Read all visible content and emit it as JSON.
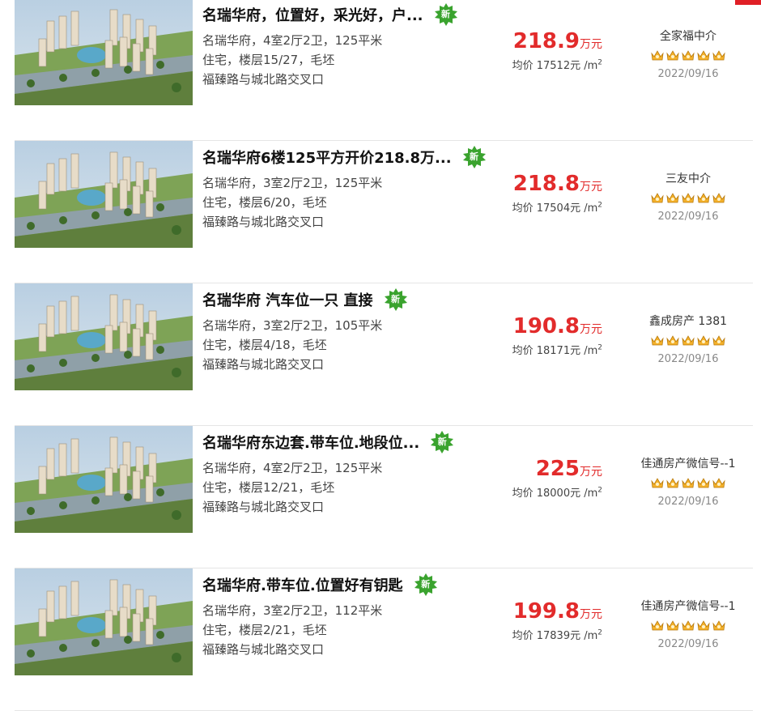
{
  "accent_color": "#e22b2b",
  "new_badge_color": "#3aa32e",
  "listings": [
    {
      "title": "名瑞华府，位置好，采光好，户...",
      "badge": "新",
      "line1": "名瑞华府，4室2厅2卫，125平米",
      "line2": "住宅，楼层15/27，毛坯",
      "address": "福臻路与城北路交叉口",
      "price": "218.9",
      "price_unit": "万元",
      "avg_label": "均价",
      "avg_price": "17512元 /m",
      "avg_sup": "2",
      "agent": "全家福中介",
      "rating": 5,
      "rating_icon": "crown-icon",
      "date": "2022/09/16"
    },
    {
      "title": "名瑞华府6楼125平方开价218.8万...",
      "badge": "新",
      "line1": "名瑞华府，3室2厅2卫，125平米",
      "line2": "住宅，楼层6/20，毛坯",
      "address": "福臻路与城北路交叉口",
      "price": "218.8",
      "price_unit": "万元",
      "avg_label": "均价",
      "avg_price": "17504元 /m",
      "avg_sup": "2",
      "agent": "三友中介",
      "rating": 5,
      "rating_icon": "crown-icon",
      "date": "2022/09/16"
    },
    {
      "title": "名瑞华府 汽车位一只 直接",
      "badge": "新",
      "line1": "名瑞华府，3室2厅2卫，105平米",
      "line2": "住宅，楼层4/18，毛坯",
      "address": "福臻路与城北路交叉口",
      "price": "190.8",
      "price_unit": "万元",
      "avg_label": "均价",
      "avg_price": "18171元 /m",
      "avg_sup": "2",
      "agent": "鑫成房产 1381",
      "rating": 5,
      "rating_icon": "crown-icon",
      "date": "2022/09/16"
    },
    {
      "title": "名瑞华府东边套.带车位.地段位...",
      "badge": "新",
      "line1": "名瑞华府，4室2厅2卫，125平米",
      "line2": "住宅，楼层12/21，毛坯",
      "address": "福臻路与城北路交叉口",
      "price": "225",
      "price_unit": "万元",
      "avg_label": "均价",
      "avg_price": "18000元 /m",
      "avg_sup": "2",
      "agent": "佳通房产微信号--1",
      "rating": 5,
      "rating_icon": "crown-icon",
      "date": "2022/09/16"
    },
    {
      "title": "名瑞华府.带车位.位置好有钥匙",
      "badge": "新",
      "line1": "名瑞华府，3室2厅2卫，112平米",
      "line2": "住宅，楼层2/21，毛坯",
      "address": "福臻路与城北路交叉口",
      "price": "199.8",
      "price_unit": "万元",
      "avg_label": "均价",
      "avg_price": "17839元 /m",
      "avg_sup": "2",
      "agent": "佳通房产微信号--1",
      "rating": 5,
      "rating_icon": "crown-icon",
      "date": "2022/09/16"
    }
  ]
}
